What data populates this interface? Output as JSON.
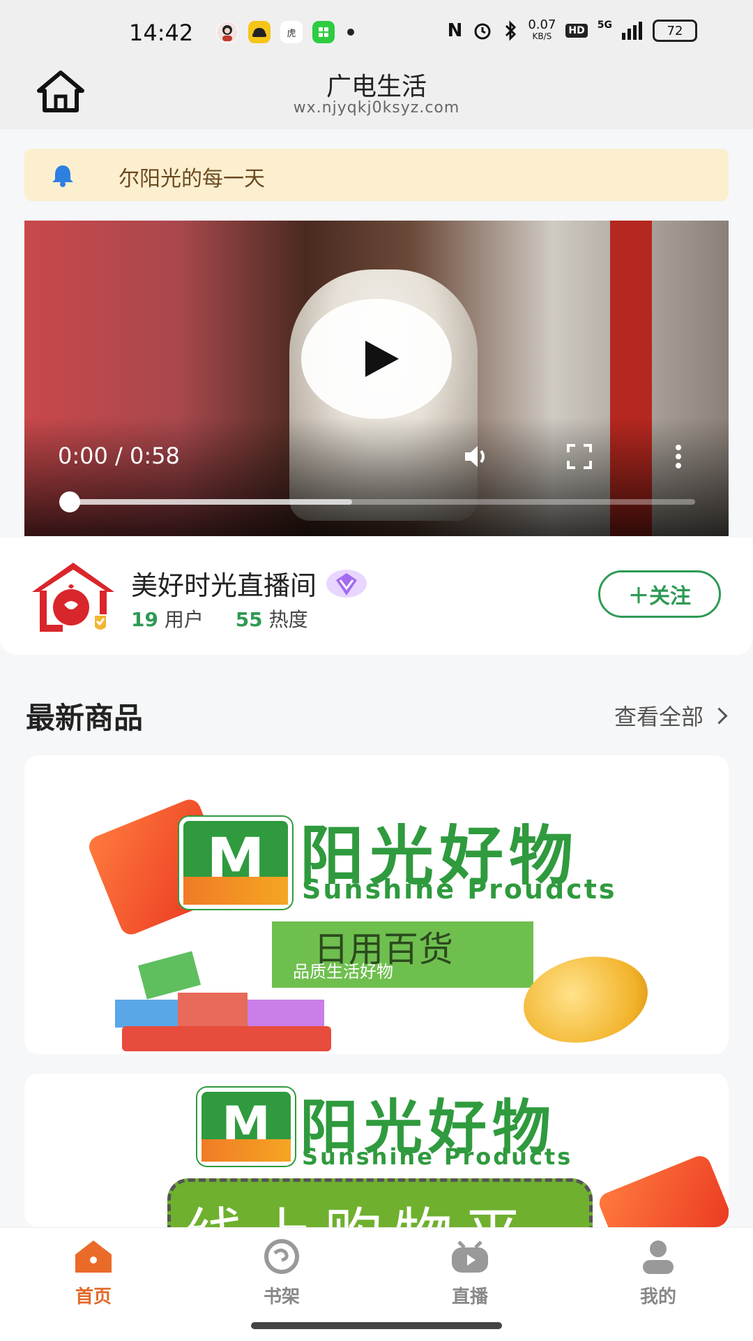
{
  "status_bar": {
    "time": "14:42",
    "network_speed": "0.07",
    "network_speed_unit": "KB/S",
    "hd": "HD",
    "signal": "5G",
    "battery": "72"
  },
  "header": {
    "title": "广电生活",
    "url": "wx.njyqkj0ksyz.com"
  },
  "notice": {
    "text": "尔阳光的每一天"
  },
  "video": {
    "time": "0:00 / 0:58",
    "buffered_fraction": 0.46
  },
  "live_room": {
    "name": "美好时光直播间",
    "users_count": "19",
    "users_label": "用户",
    "heat_count": "55",
    "heat_label": "热度",
    "follow_label": "＋关注"
  },
  "products_section": {
    "title": "最新商品",
    "view_all": "查看全部",
    "banners": [
      {
        "brand_cn": "阳光好物",
        "brand_en": "Sunshine Proudcts",
        "category": "日用百货",
        "slogan": "品质生活好物"
      },
      {
        "brand_cn": "阳光好物",
        "brand_en": "Sunshine Products",
        "category": "线上购物平台"
      }
    ]
  },
  "tabbar": {
    "items": [
      {
        "label": "首页"
      },
      {
        "label": "书架"
      },
      {
        "label": "直播"
      },
      {
        "label": "我的"
      }
    ]
  },
  "colors": {
    "accent_green": "#2f9a55",
    "active_tab": "#e06a2a",
    "notice_bg": "#fbefd0"
  }
}
